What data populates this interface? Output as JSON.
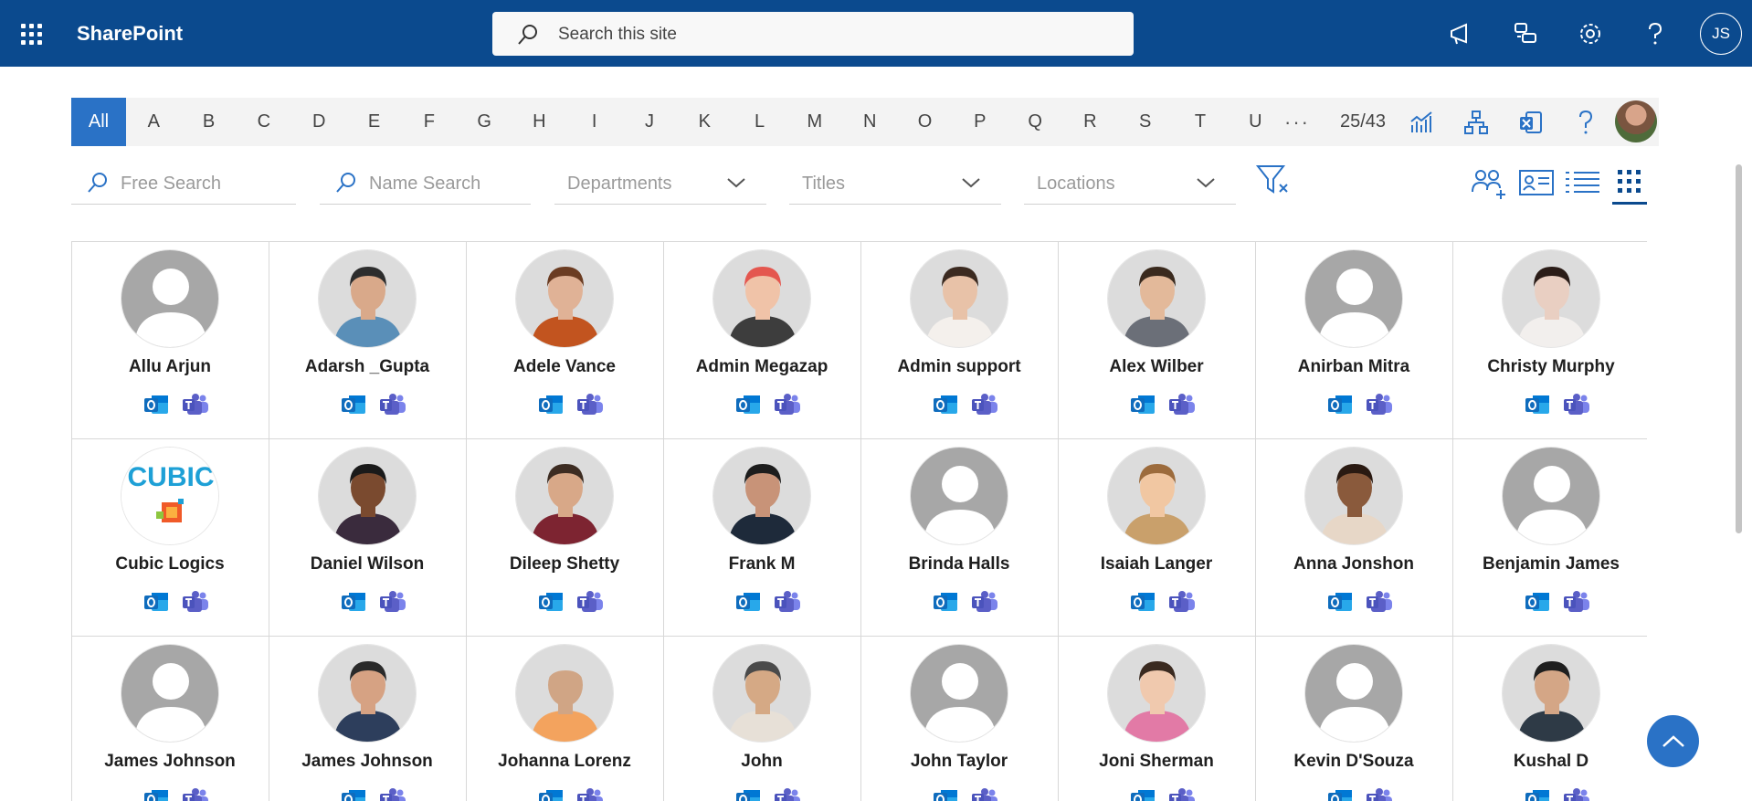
{
  "suitebar": {
    "app_name": "SharePoint",
    "search_placeholder": "Search this site",
    "user_initials": "JS"
  },
  "alphabet": {
    "letters": [
      "All",
      "A",
      "B",
      "C",
      "D",
      "E",
      "F",
      "G",
      "H",
      "I",
      "J",
      "K",
      "L",
      "M",
      "N",
      "O",
      "P",
      "Q",
      "R",
      "S",
      "T",
      "U"
    ],
    "active": "All",
    "more": "···",
    "count": "25/43"
  },
  "filters": {
    "free_search": "Free Search",
    "name_search": "Name Search",
    "departments": "Departments",
    "titles": "Titles",
    "locations": "Locations"
  },
  "people": [
    {
      "name": "Allu Arjun",
      "photo": "placeholder"
    },
    {
      "name": "Adarsh _Gupta",
      "photo": "photo"
    },
    {
      "name": "Adele Vance",
      "photo": "photo"
    },
    {
      "name": "Admin Megazap",
      "photo": "photo"
    },
    {
      "name": "Admin support",
      "photo": "photo"
    },
    {
      "name": "Alex Wilber",
      "photo": "photo"
    },
    {
      "name": "Anirban Mitra",
      "photo": "placeholder"
    },
    {
      "name": "Christy Murphy",
      "photo": "photo"
    },
    {
      "name": "Cubic Logics",
      "photo": "logo"
    },
    {
      "name": "Daniel Wilson",
      "photo": "photo"
    },
    {
      "name": "Dileep Shetty",
      "photo": "photo"
    },
    {
      "name": "Frank M",
      "photo": "photo"
    },
    {
      "name": "Brinda Halls",
      "photo": "placeholder"
    },
    {
      "name": "Isaiah Langer",
      "photo": "photo"
    },
    {
      "name": "Anna Jonshon",
      "photo": "photo"
    },
    {
      "name": "Benjamin James",
      "photo": "placeholder"
    },
    {
      "name": "James Johnson",
      "photo": "placeholder"
    },
    {
      "name": "James Johnson",
      "photo": "photo"
    },
    {
      "name": "Johanna Lorenz",
      "photo": "photo"
    },
    {
      "name": "John",
      "photo": "photo"
    },
    {
      "name": "John Taylor",
      "photo": "placeholder"
    },
    {
      "name": "Joni Sherman",
      "photo": "photo"
    },
    {
      "name": "Kevin D'Souza",
      "photo": "placeholder"
    },
    {
      "name": "Kushal D",
      "photo": "photo"
    }
  ],
  "logo_text": "CUBIC",
  "colors": {
    "suitebar": "#0b4a8e",
    "accent": "#2a72c6",
    "outlook": "#0f6cbd",
    "teams": "#5b5fc7"
  }
}
